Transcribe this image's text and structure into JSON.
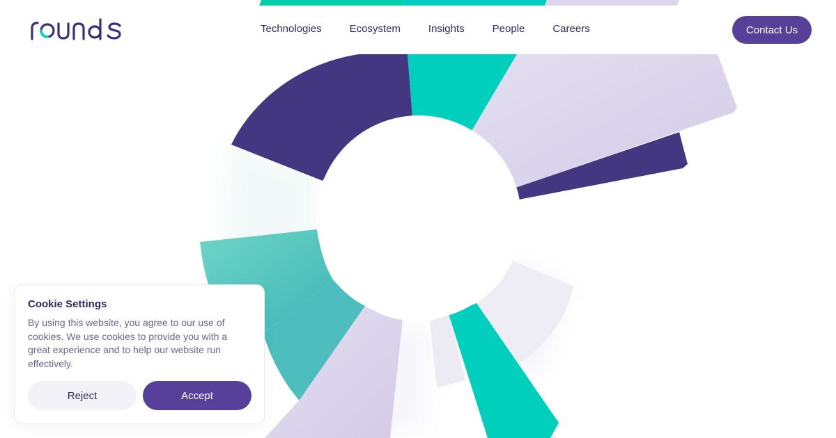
{
  "brand": {
    "logo_text": "rounds",
    "colors": {
      "primary": "#56409a",
      "dark_purple": "#433781",
      "teal": "#00cfbe",
      "lavender": "#dcd5ec",
      "text": "#2e2a5e"
    }
  },
  "nav": {
    "items": [
      {
        "label": "Technologies"
      },
      {
        "label": "Ecosystem"
      },
      {
        "label": "Insights"
      },
      {
        "label": "People"
      },
      {
        "label": "Careers"
      }
    ],
    "contact_label": "Contact Us"
  },
  "hero": {
    "graphic": "radial-segment-ring-illustration"
  },
  "cookie": {
    "title": "Cookie Settings",
    "text": "By using this website, you agree to our use of cookies. We use cookies to provide you with a great experience and to help our website run effectively.",
    "reject_label": "Reject",
    "accept_label": "Accept"
  }
}
